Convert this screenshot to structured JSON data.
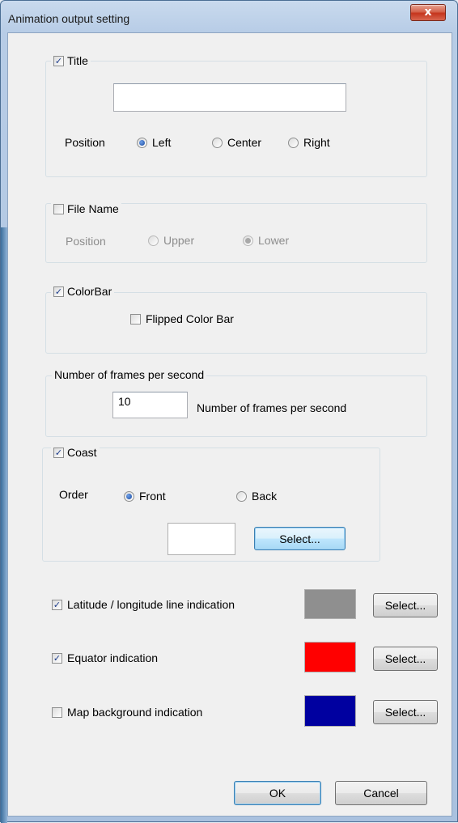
{
  "window": {
    "title": "Animation output setting",
    "close_glyph": "x"
  },
  "title_group": {
    "label": "Title",
    "checked": true,
    "input_value": "",
    "position_label": "Position",
    "options": [
      "Left",
      "Center",
      "Right"
    ],
    "selected": "Left"
  },
  "filename_group": {
    "label": "File Name",
    "checked": false,
    "position_label": "Position",
    "options": [
      "Upper",
      "Lower"
    ],
    "selected": "Lower"
  },
  "colorbar_group": {
    "label": "ColorBar",
    "checked": true,
    "flipped_label": "Flipped Color Bar",
    "flipped_checked": false
  },
  "fps_group": {
    "legend": "Number of frames per second",
    "value": "10",
    "unit_label": "Number of frames per second"
  },
  "coast_group": {
    "label": "Coast",
    "checked": true,
    "order_label": "Order",
    "options": [
      "Front",
      "Back"
    ],
    "selected": "Front",
    "select_label": "Select...",
    "color": "#ffffff"
  },
  "lines": [
    {
      "label": "Latitude / longitude line indication",
      "checked": true,
      "color": "#8f8f8f",
      "select_label": "Select..."
    },
    {
      "label": "Equator indication",
      "checked": true,
      "color": "#ff0000",
      "select_label": "Select..."
    },
    {
      "label": "Map background indication",
      "checked": false,
      "color": "#0000a0",
      "select_label": "Select..."
    }
  ],
  "footer": {
    "ok_label": "OK",
    "cancel_label": "Cancel"
  }
}
